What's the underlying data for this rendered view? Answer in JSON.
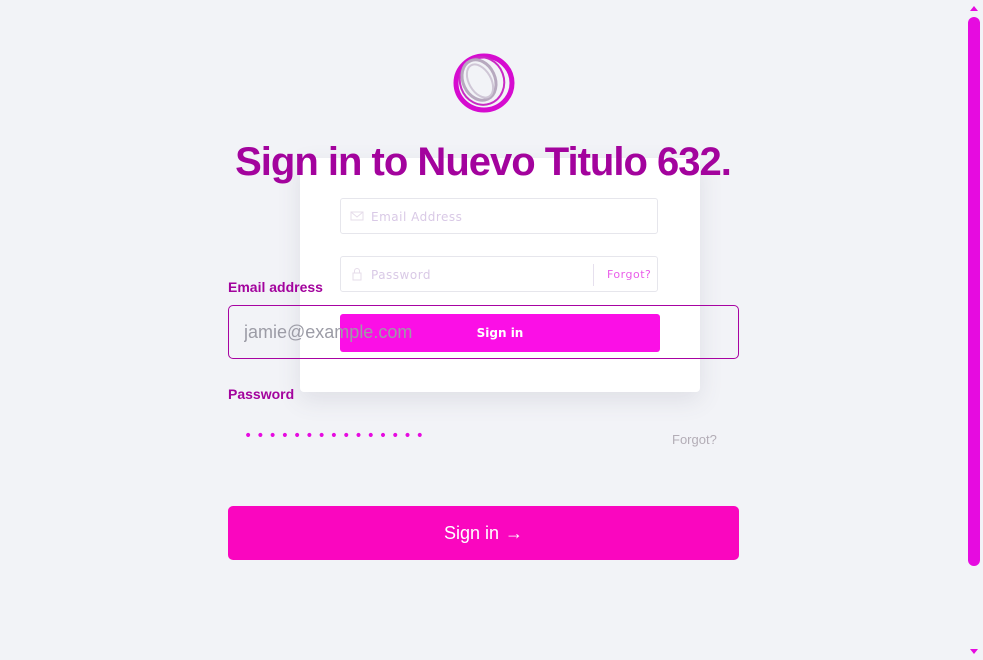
{
  "logo": {
    "icon": "ring-logo-icon",
    "color": "#d60bd0"
  },
  "headline": "Sign in to Nuevo Titulo 632.",
  "ghost_card": {
    "email_placeholder": "Email Address",
    "password_placeholder": "Password",
    "forgot_label": "Forgot?",
    "signin_label": "Sign in",
    "email_icon": "envelope-icon",
    "password_icon": "lock-icon"
  },
  "form": {
    "email_label": "Email address",
    "email_placeholder": "jamie@example.com",
    "password_label": "Password",
    "password_masked": "•••••••••••••••",
    "forgot_label": "Forgot?",
    "signin_label": "Sign in",
    "signin_arrow": "→"
  },
  "colors": {
    "accent": "#fa06bf",
    "heading": "#a3039d",
    "scrollbar": "#e60be0",
    "background": "#f2f3f7"
  }
}
